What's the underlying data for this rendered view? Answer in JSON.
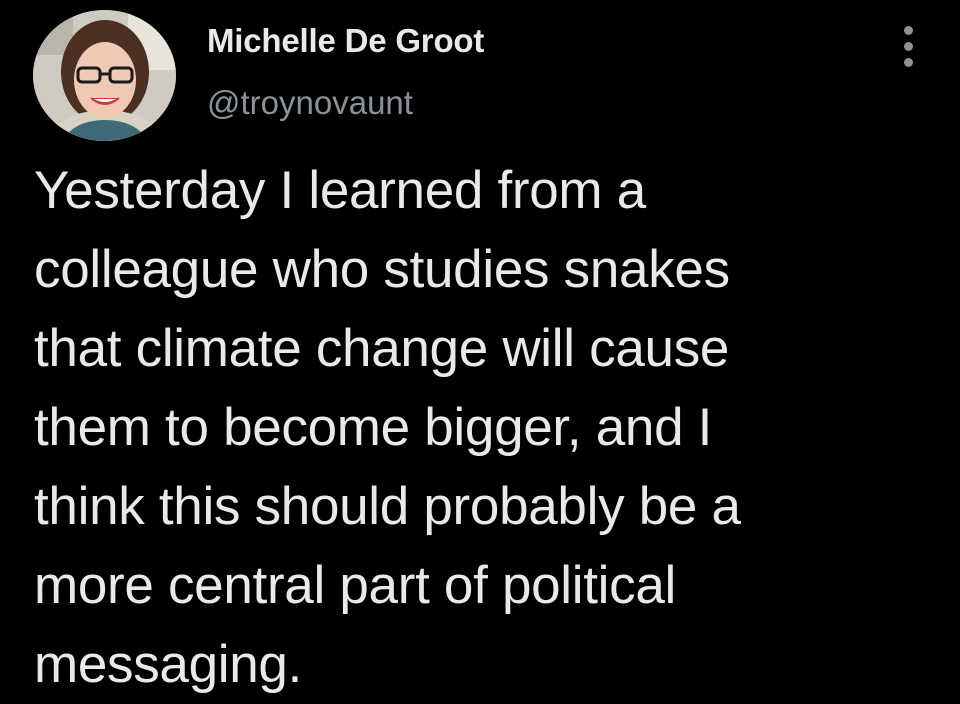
{
  "author": {
    "display_name": "Michelle De Groot",
    "handle": "@troynovaunt",
    "avatar_icon": "profile-photo"
  },
  "menu": {
    "icon": "more-options-icon"
  },
  "tweet": {
    "text": "Yesterday I learned from a\ncolleague who studies snakes\nthat climate change will cause\nthem to become bigger, and I\nthink this should probably be a\nmore central part of political\nmessaging."
  },
  "colors": {
    "background": "#000000",
    "primary_text": "#e7e9ea",
    "secondary_text": "#8b9197"
  }
}
